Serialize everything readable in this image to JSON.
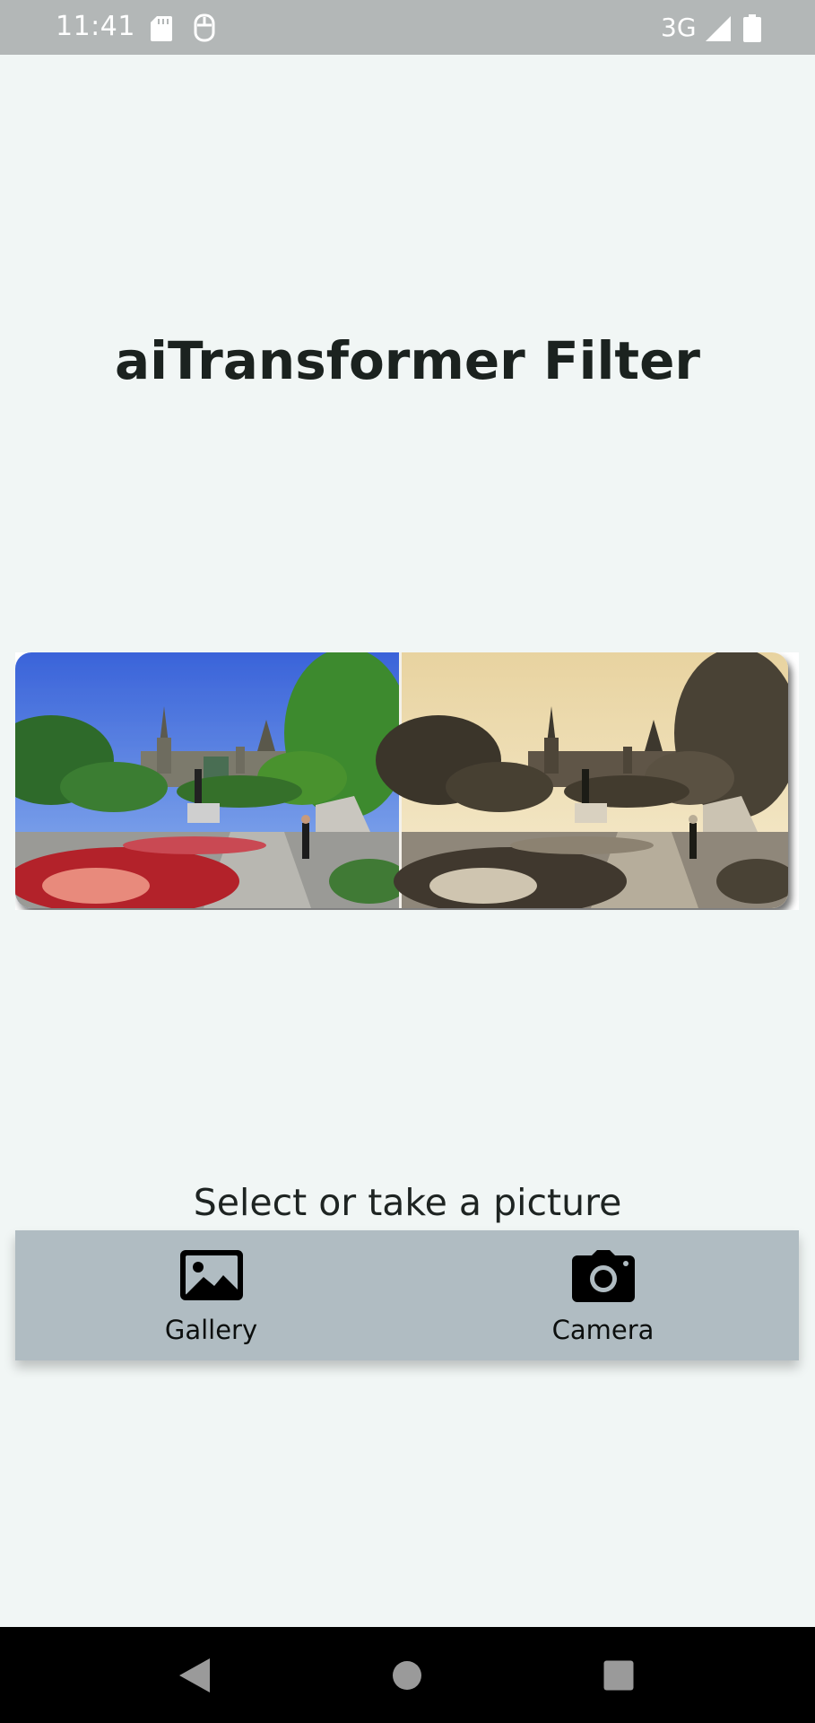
{
  "status_bar": {
    "time": "11:41",
    "network": "3G",
    "icons": [
      "sd-card-icon",
      "sim-icon",
      "signal-icon",
      "battery-icon"
    ]
  },
  "app": {
    "title": "aiTransformer Filter",
    "preview": {
      "left_label": "original photo",
      "right_label": "sepia filtered photo"
    },
    "prompt": "Select or take a picture",
    "actions": {
      "gallery_label": "Gallery",
      "gallery_icon": "image-icon",
      "camera_label": "Camera",
      "camera_icon": "camera-icon"
    }
  },
  "nav_bar": {
    "buttons": [
      "back-icon",
      "home-icon",
      "recents-icon"
    ]
  },
  "colors": {
    "background": "#f1f6f5",
    "status_bar": "#b3b7b7",
    "action_bar": "#b0bcc2",
    "title_text": "#1b221f"
  }
}
